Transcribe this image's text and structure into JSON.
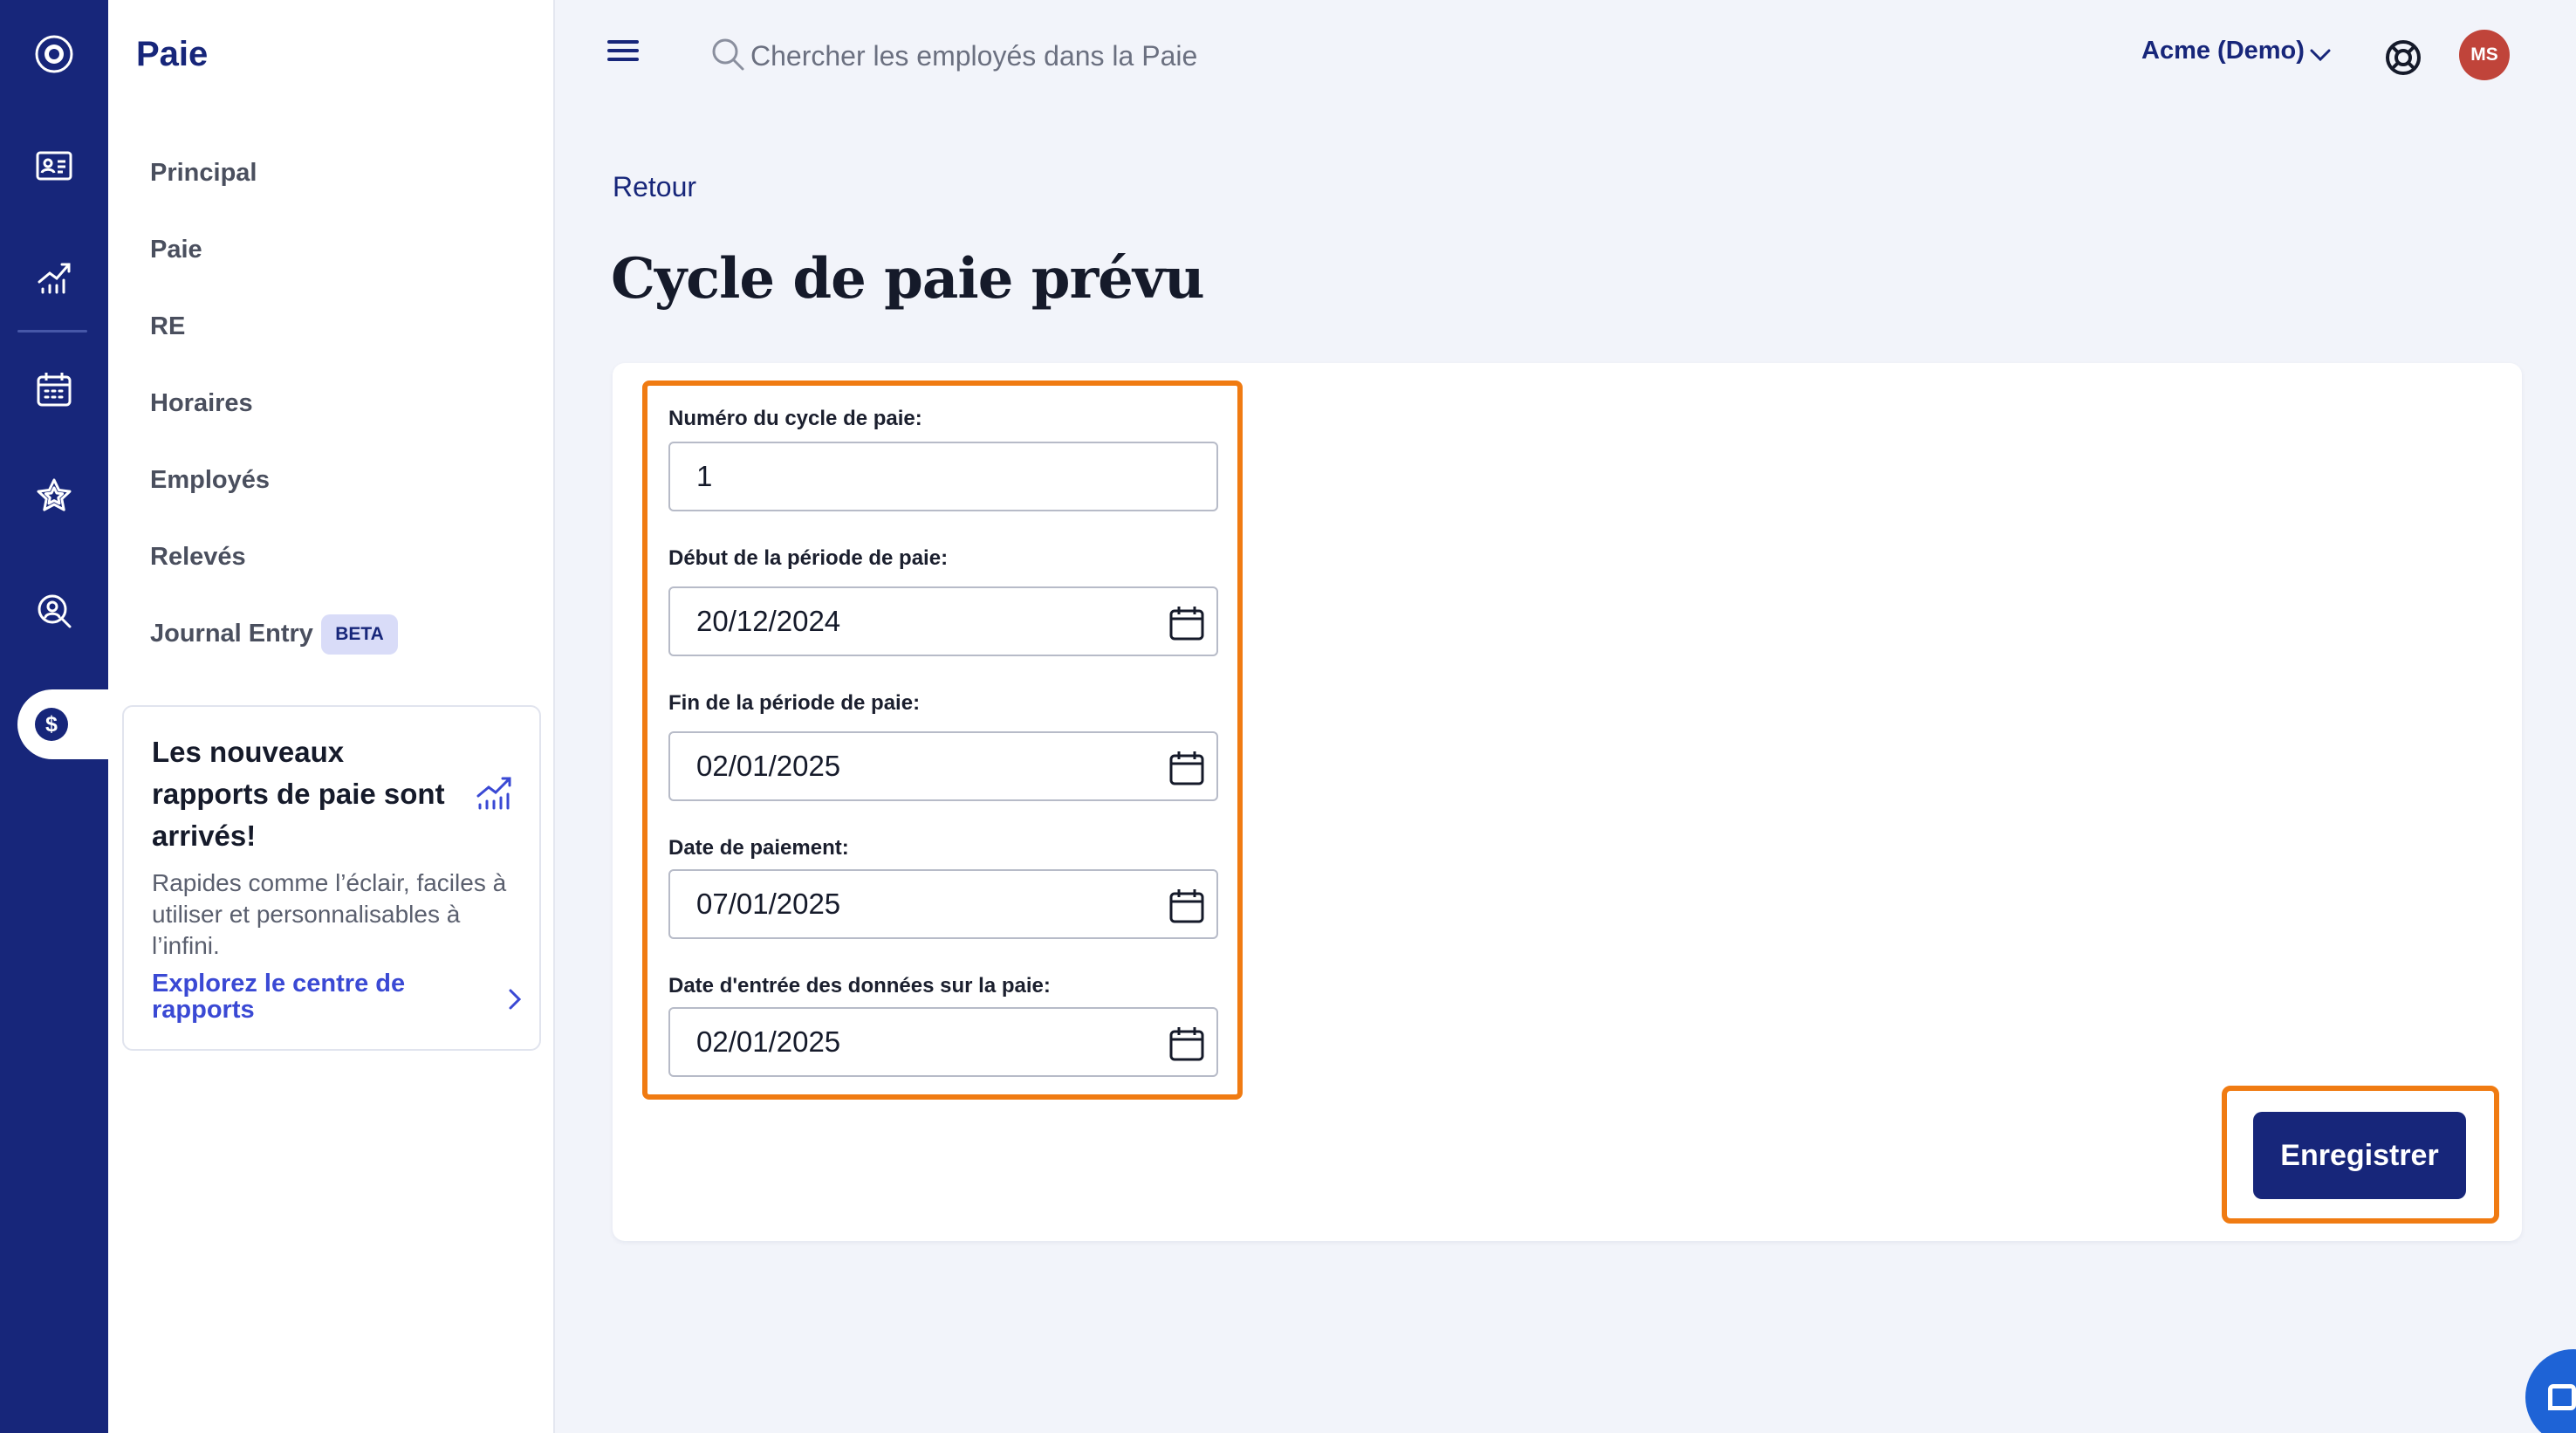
{
  "app": {
    "title": "Paie"
  },
  "rail": {
    "items": [
      {
        "icon": "logo-icon"
      },
      {
        "icon": "id-card-icon"
      },
      {
        "icon": "trend-chart-icon"
      },
      {
        "icon": "calendar-icon"
      },
      {
        "icon": "star-icon"
      },
      {
        "icon": "person-search-icon"
      },
      {
        "icon": "dollar-icon",
        "active": true
      }
    ]
  },
  "sidebar": {
    "items": [
      {
        "label": "Principal"
      },
      {
        "label": "Paie"
      },
      {
        "label": "RE"
      },
      {
        "label": "Horaires"
      },
      {
        "label": "Employés"
      },
      {
        "label": "Relevés"
      },
      {
        "label": "Journal Entry",
        "badge": "BETA"
      }
    ],
    "promo": {
      "title": "Les nouveaux rapports de paie sont arrivés!",
      "body": "Rapides comme l’éclair, faciles à utiliser et personnalisables à l’infini.",
      "link": "Explorez le centre de rapports"
    }
  },
  "header": {
    "search_placeholder": "Chercher les employés dans la Paie",
    "company": "Acme (Demo)",
    "avatar_initials": "MS"
  },
  "main": {
    "back_label": "Retour",
    "title": "Cycle de paie prévu",
    "fields": {
      "cycle_number": {
        "label": "Numéro du cycle de paie:",
        "value": "1"
      },
      "period_start": {
        "label": "Début de la période de paie:",
        "value": "20/12/2024"
      },
      "period_end": {
        "label": "Fin de la période de paie:",
        "value": "02/01/2025"
      },
      "payment_date": {
        "label": "Date de paiement:",
        "value": "07/01/2025"
      },
      "data_entry_date": {
        "label": "Date d'entrée des données sur la paie:",
        "value": "02/01/2025"
      }
    },
    "save_label": "Enregistrer"
  },
  "colors": {
    "brand": "#17267a",
    "highlight": "#f07b12",
    "avatar": "#c0443a",
    "link": "#3a49d4"
  }
}
